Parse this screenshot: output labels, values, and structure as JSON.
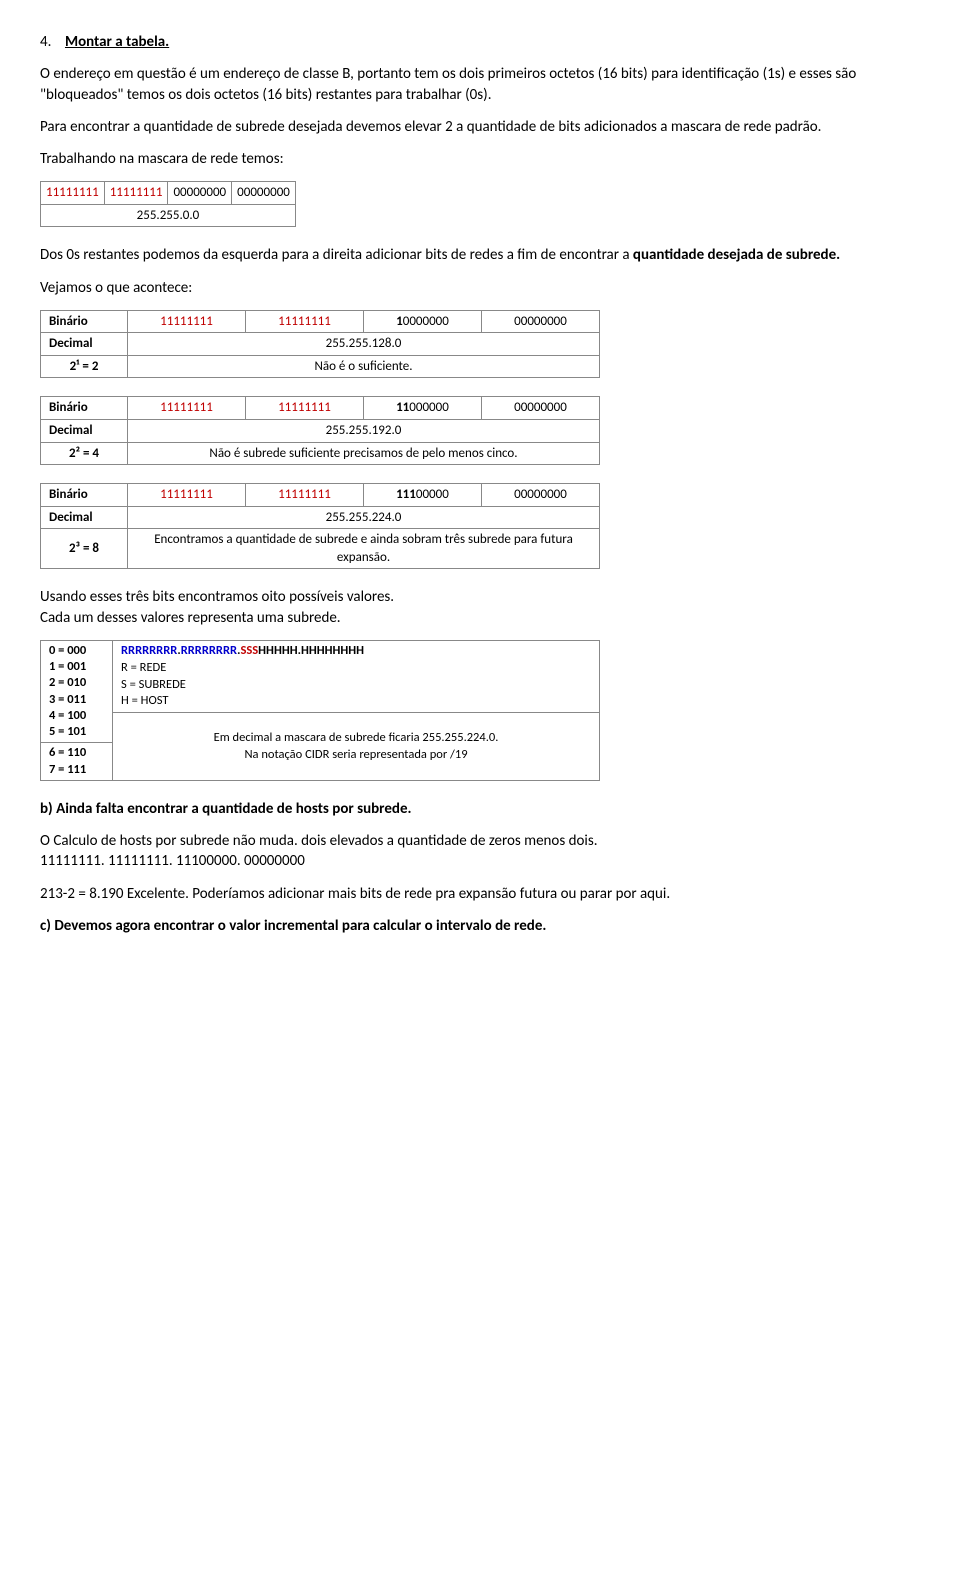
{
  "h4_number": "4.",
  "h4_title": "Montar a tabela.",
  "p1": "O endereço em questão é um endereço de classe B, portanto tem os dois primeiros octetos (16 bits) para identificação (1s) e esses são \"bloqueados\" temos os dois octetos (16 bits) restantes para trabalhar (0s).",
  "p2": "Para encontrar a quantidade de subrede desejada devemos elevar 2 a quantidade de bits adicionados a mascara de rede padrão.",
  "p3": "Trabalhando na mascara de rede temos:",
  "mask_table": {
    "c1": "11111111",
    "c2": "11111111",
    "c3": "00000000",
    "c4": "00000000",
    "dec": "255.255.0.0"
  },
  "p4a": "Dos 0s restantes podemos da esquerda para a direita adicionar bits de redes a fim de encontrar a ",
  "p4b": "quantidade desejada de subrede.",
  "p5": "Vejamos o que acontece:",
  "tb1": {
    "row1_label": "Binário",
    "r1c1": "11111111",
    "r1c2": "11111111",
    "r1c3a": "1",
    "r1c3b": "0000000",
    "r1c4": "00000000",
    "row2_label": "Decimal",
    "r2v": "255.255.128.0",
    "row3_label": "2¹ = 2",
    "r3v": "Não é o suficiente."
  },
  "tb2": {
    "row1_label": "Binário",
    "r1c1": "11111111",
    "r1c2": "11111111",
    "r1c3a": "11",
    "r1c3b": "000000",
    "r1c4": "00000000",
    "row2_label": "Decimal",
    "r2v": "255.255.192.0",
    "row3_label": "2² = 4",
    "r3v": "Não é subrede suficiente precisamos de pelo menos cinco."
  },
  "tb3": {
    "row1_label": "Binário",
    "r1c1": "11111111",
    "r1c2": "11111111",
    "r1c3a": "111",
    "r1c3b": "00000",
    "r1c4": "00000000",
    "row2_label": "Decimal",
    "r2v": "255.255.224.0",
    "row3_label": "2³ = 8",
    "r3v": "Encontramos a quantidade de subrede e ainda sobram três subrede para futura expansão."
  },
  "p6a": "Usando esses três bits encontramos oito possíveis valores.",
  "p6b": "Cada um desses valores representa uma subrede.",
  "valtable": {
    "left": [
      "0 = 000",
      "1 = 001",
      "2 = 010",
      "3 = 011",
      "4 = 100",
      "5 = 101",
      "6 = 110",
      "7 = 111"
    ],
    "right_top_r": "RRRRRRRR",
    "right_top_r2": "RRRRRRRR",
    "right_top_s": "SSS",
    "right_top_h1": "HHHHH",
    "right_top_h2": "HHHHHHHH",
    "r_line": "R = REDE",
    "s_line": "S = SUBREDE",
    "h_line": "H = HOST",
    "bottom_a": "Em decimal a mascara de subrede ficaria 255.255.224.0.",
    "bottom_b": "Na notação CIDR seria representada por /19"
  },
  "pb": "b) Ainda falta encontrar a quantidade de hosts por subrede.",
  "p7a": "O Calculo de hosts por subrede não muda. dois elevados a quantidade de zeros menos dois.",
  "p7b": "11111111. 11111111. 11100000. 00000000",
  "p8": "213-2 = 8.190 Excelente. Poderíamos adicionar mais bits de rede pra expansão futura ou parar por aqui.",
  "pc": "c) Devemos agora encontrar o valor incremental para calcular o intervalo de rede."
}
